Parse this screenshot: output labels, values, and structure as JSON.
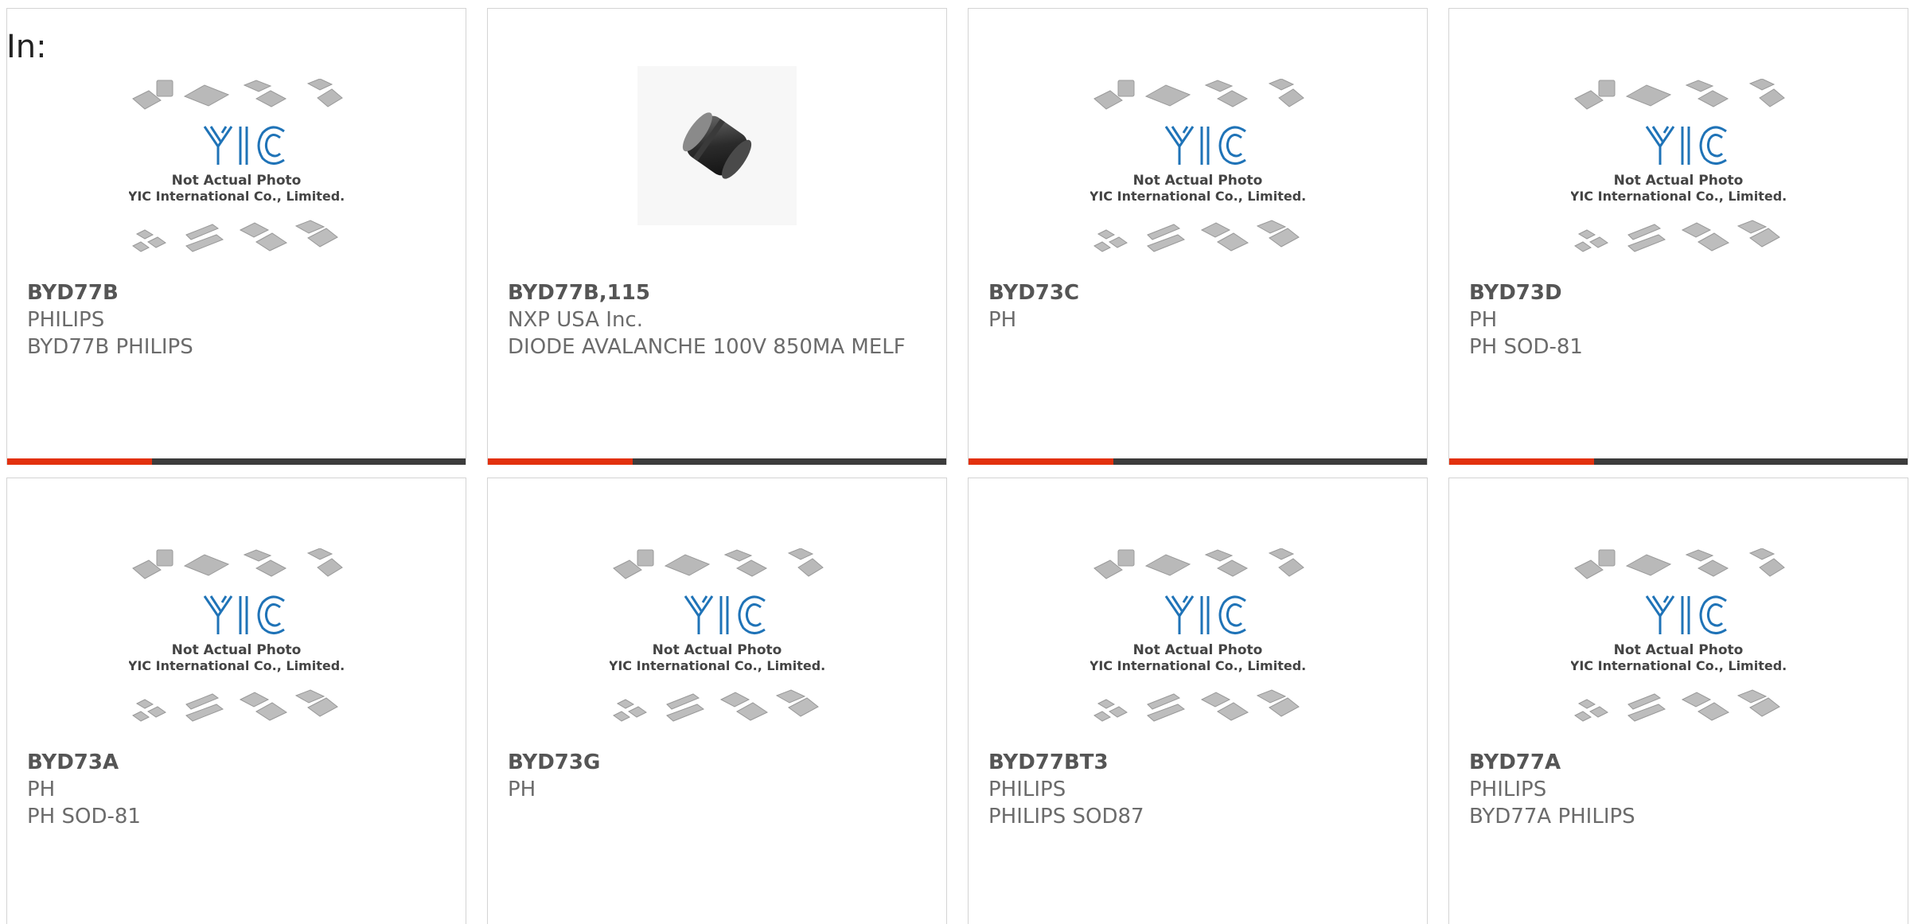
{
  "header": {
    "label": "In:"
  },
  "placeholder": {
    "line1": "Not Actual Photo",
    "line2": "YIC International Co., Limited.",
    "logo_text": "YIC"
  },
  "colors": {
    "accent": "#e2310e",
    "bar": "#3c3c3c",
    "logo": "#1f73b7",
    "text": "#6b6b6b"
  },
  "products": [
    {
      "part": "BYD77B",
      "manufacturer": "PHILIPS",
      "description": "BYD77B PHILIPS",
      "image": "placeholder-photo"
    },
    {
      "part": "BYD77B,115",
      "manufacturer": "NXP USA Inc.",
      "description": "DIODE AVALANCHE 100V 850MA MELF",
      "image": "diode-photo"
    },
    {
      "part": "BYD73C",
      "manufacturer": "PH",
      "description": "",
      "image": "placeholder-photo"
    },
    {
      "part": "BYD73D",
      "manufacturer": "PH",
      "description": "PH SOD-81",
      "image": "placeholder-photo"
    },
    {
      "part": "BYD73A",
      "manufacturer": "PH",
      "description": "PH SOD-81",
      "image": "placeholder-photo"
    },
    {
      "part": "BYD73G",
      "manufacturer": "PH",
      "description": "",
      "image": "placeholder-photo"
    },
    {
      "part": "BYD77BT3",
      "manufacturer": "PHILIPS",
      "description": "PHILIPS SOD87",
      "image": "placeholder-photo"
    },
    {
      "part": "BYD77A",
      "manufacturer": "PHILIPS",
      "description": "BYD77A PHILIPS",
      "image": "placeholder-photo"
    }
  ]
}
